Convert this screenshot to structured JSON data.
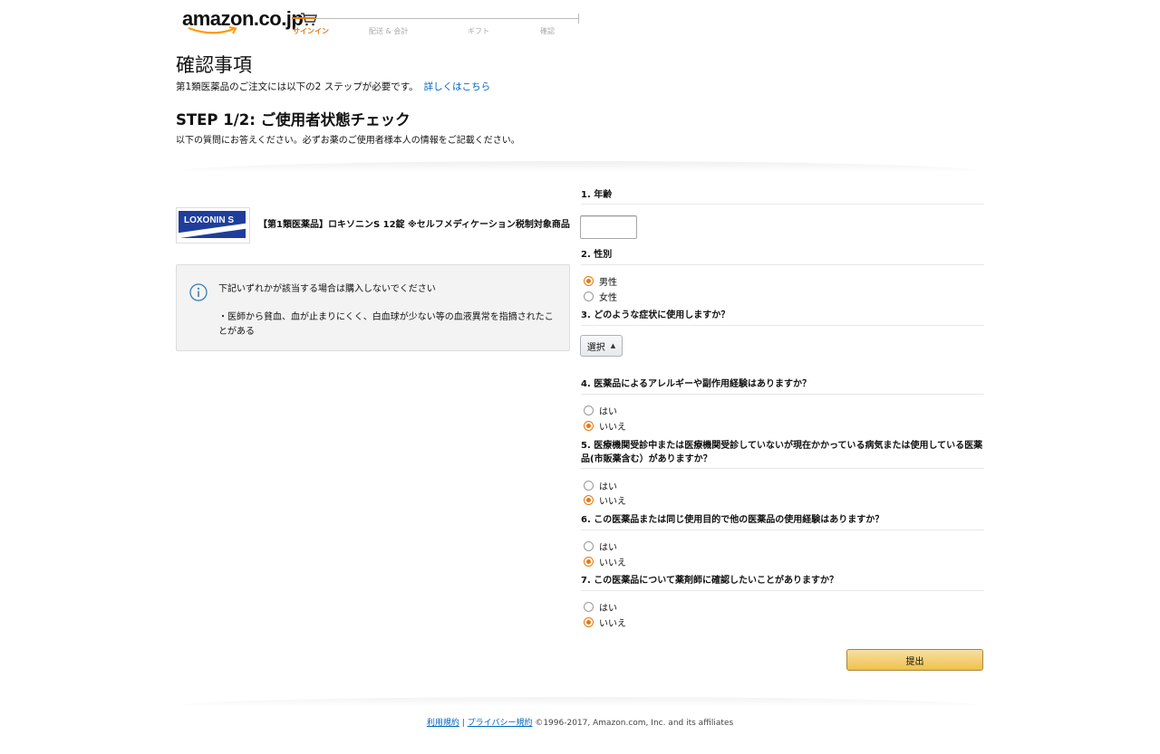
{
  "header": {
    "logo_text": "amazon.co.jp",
    "steps": [
      "サインイン",
      "配送 & 会計",
      "ギフト",
      "確認"
    ],
    "active_step": 0,
    "accent_color": "#e47911"
  },
  "page": {
    "title": "確認事項",
    "subtitle": "第1類医薬品のご注文には以下の2 ステップが必要です。",
    "subtitle_link": "詳しくはこちら",
    "step_heading": "STEP 1/2: ご使用者状態チェック",
    "step_desc": "以下の質問にお答えください。必ずお薬のご使用者様本人の情報をご記載ください。"
  },
  "product": {
    "image_text": "LOXONIN S",
    "title": "【第1類医薬品】ロキソニンS 12錠 ※セルフメディケーション税制対象商品"
  },
  "notice": {
    "icon": "info-icon",
    "heading": "下記いずれかが該当する場合は購入しないでください",
    "item": "・医師から貧血、血が止まりにくく、白血球が少ない等の血液異常を指摘されたことがある"
  },
  "questions": {
    "q1": {
      "label": "1. 年齢",
      "value": ""
    },
    "q2": {
      "label": "2. 性別",
      "options": [
        "男性",
        "女性"
      ],
      "selected": "男性"
    },
    "q3": {
      "label": "3. どのような症状に使用しますか？",
      "select_value": "選択"
    },
    "q4": {
      "label": "4. 医薬品によるアレルギーや副作用経験はありますか？",
      "options": [
        "はい",
        "いいえ"
      ],
      "selected": "いいえ"
    },
    "q5": {
      "label": "5. 医療機関受診中または医療機関受診していないが現在かかっている病気または使用している医薬品(市販薬含む）がありますか？",
      "options": [
        "はい",
        "いいえ"
      ],
      "selected": "いいえ"
    },
    "q6": {
      "label": "6. この医薬品または同じ使用目的で他の医薬品の使用経験はありますか？",
      "options": [
        "はい",
        "いいえ"
      ],
      "selected": "いいえ"
    },
    "q7": {
      "label": "7. この医薬品について薬剤師に確認したいことがありますか？",
      "options": [
        "はい",
        "いいえ"
      ],
      "selected": "いいえ"
    }
  },
  "submit_label": "提出",
  "footer": {
    "terms": "利用規約",
    "separator": "|",
    "privacy": "プライバシー規約",
    "copyright": "©1996-2017, Amazon.com, Inc. and its affiliates"
  }
}
